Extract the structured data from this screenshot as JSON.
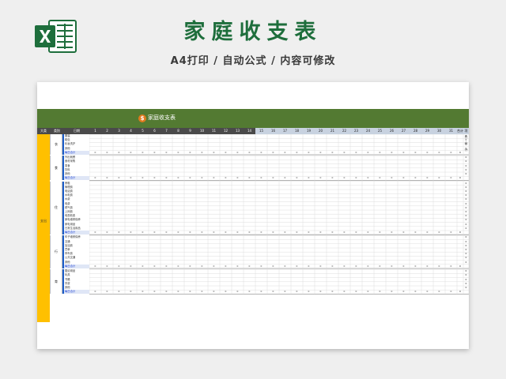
{
  "header": {
    "title": "家庭收支表",
    "subtitle": "A4打印 / 自动公式 / 内容可修改",
    "logo_icon": "excel-icon",
    "accent_color": "#1e6e3c"
  },
  "sheet": {
    "banner_title": "家庭收支表",
    "banner_icon": "coin-icon",
    "banner_color": "#537a32",
    "column_headers": {
      "a": "大类",
      "b": "类别",
      "c": "日期",
      "days": [
        "1",
        "2",
        "3",
        "4",
        "5",
        "6",
        "7",
        "8",
        "9",
        "10",
        "11",
        "12",
        "13",
        "14",
        "15",
        "16",
        "17",
        "18",
        "19",
        "20",
        "21",
        "22",
        "23",
        "24",
        "25",
        "26",
        "27",
        "28",
        "29",
        "30",
        "31"
      ],
      "total": "合计",
      "sub_total": "项目合计"
    },
    "main_category": "支出",
    "groups": [
      {
        "name": "衣",
        "items": [
          "服装",
          "鞋包",
          "化妆洗护",
          "其他"
        ],
        "total_label": "每日合计"
      },
      {
        "name": "食",
        "items": [
          "外出就餐",
          "食材采购",
          "零食",
          "饮料",
          "其他"
        ],
        "total_label": "每日合计"
      },
      {
        "name": "住",
        "items": [
          "房租",
          "管理费",
          "电话费",
          "水电费",
          "水费",
          "电费",
          "燃气费",
          "上网费",
          "电视收费",
          "家电维修保养",
          "家电用品",
          "日常生活用品"
        ],
        "total_label": "每日合计"
      },
      {
        "name": "行",
        "items": [
          "车子维修保养",
          "交通",
          "加油费",
          "罚单",
          "停车费",
          "公共交通",
          "其他"
        ],
        "total_label": "每日合计"
      },
      {
        "name": "育",
        "items": [
          "婴幼用品",
          "玩具",
          "书籍",
          "学费",
          "其他"
        ],
        "total_label": "每日合计"
      }
    ],
    "zero": "0"
  }
}
